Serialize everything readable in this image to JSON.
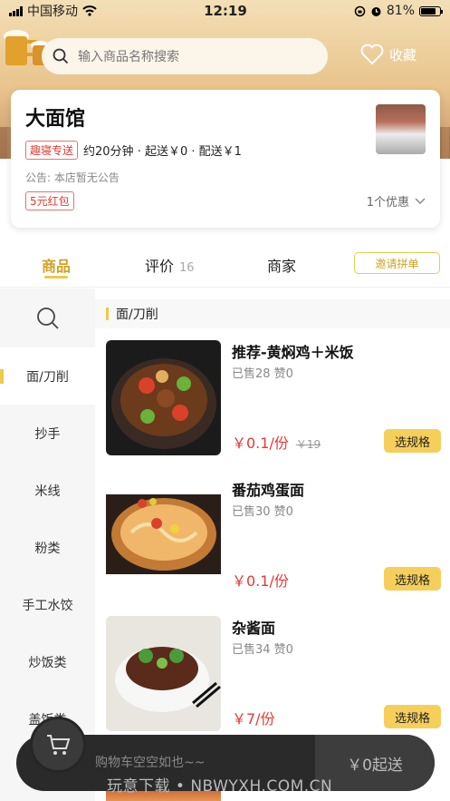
{
  "status_bar": {
    "carrier": "中国移动",
    "time": "12:19",
    "battery": "81%",
    "battery_level": 0.81
  },
  "header": {
    "search_placeholder": "输入商品名称搜索",
    "favorite_label": "收藏"
  },
  "shop": {
    "name": "大面馆",
    "tag": "趣寝专送",
    "delivery_info": "约20分钟 · 起送￥0 · 配送￥1",
    "notice": "公告: 本店暂无公告",
    "coupon": "5元红包",
    "discount_count": "1个优惠"
  },
  "tabs": {
    "goods": "商品",
    "reviews": "评价",
    "review_count": "16",
    "merchant": "商家",
    "invite": "邀请拼单"
  },
  "sidebar": {
    "items": [
      {
        "label": "面/刀削",
        "active": true
      },
      {
        "label": "抄手"
      },
      {
        "label": "米线"
      },
      {
        "label": "粉类"
      },
      {
        "label": "手工水饺"
      },
      {
        "label": "炒饭类"
      },
      {
        "label": "盖饭类"
      }
    ]
  },
  "category_title": "面/刀削",
  "products": [
    {
      "name": "推荐-黄焖鸡＋米饭",
      "sales": "已售28 赞0",
      "price": "￥0.1/份",
      "old_price": "￥19",
      "button": "选规格"
    },
    {
      "name": "番茄鸡蛋面",
      "sales": "已售30 赞0",
      "price": "￥0.1/份",
      "button": "选规格"
    },
    {
      "name": "杂酱面",
      "sales": "已售34 赞0",
      "price": "￥7/份",
      "button": "选规格"
    }
  ],
  "cart": {
    "empty_text": "购物车空空如也~~",
    "min_order": "￥0起送"
  },
  "watermark": "玩意下载 • NBWYXH.COM.CN"
}
